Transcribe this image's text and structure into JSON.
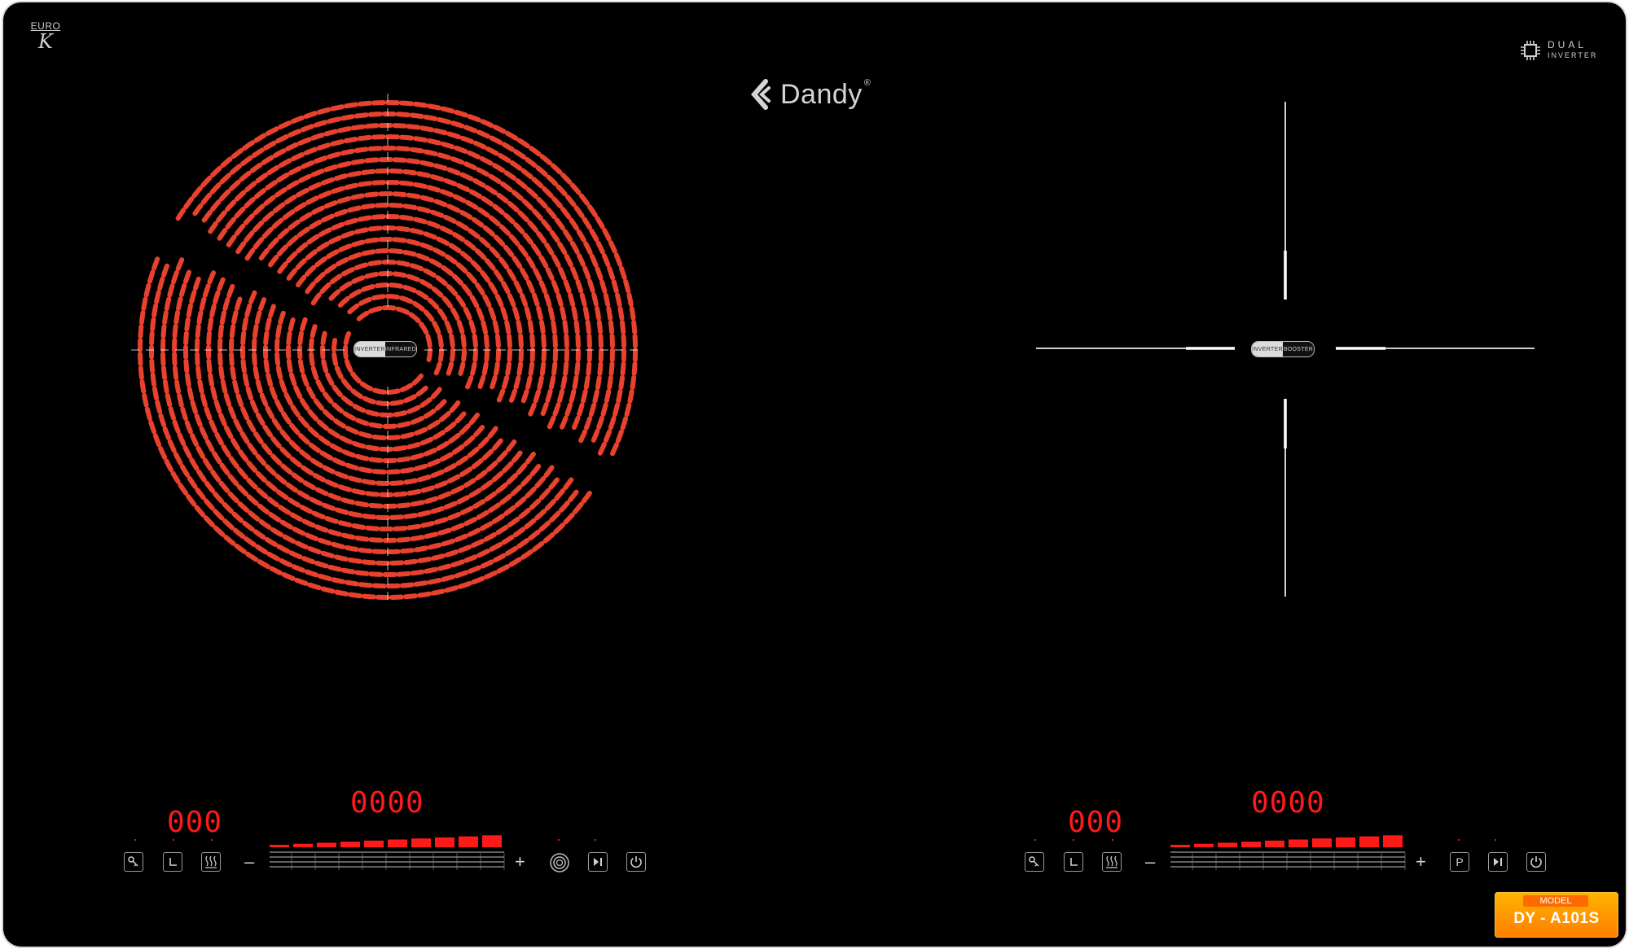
{
  "badges": {
    "euro_text": "EURO",
    "euro_mark": "K",
    "dual_line1": "DUAL",
    "dual_line2": "INVERTER"
  },
  "brand": {
    "name": "Dandy",
    "reg_mark": "®"
  },
  "zones": {
    "left": {
      "label_a": "INVERTER",
      "label_b": "INFRARED"
    },
    "right": {
      "label_a": "INVERTER",
      "label_b": "BOOSTER"
    }
  },
  "panels": {
    "left": {
      "timer": "000",
      "power": "0000",
      "minus": "–",
      "plus": "+",
      "level_bars": 10,
      "special_icon": "circle-mode-icon",
      "special_label": ""
    },
    "right": {
      "timer": "000",
      "power": "0000",
      "minus": "–",
      "plus": "+",
      "level_bars": 10,
      "special_icon": "p-mode-icon",
      "special_label": "P"
    }
  },
  "icons": [
    "key-lock-icon",
    "timer-icon",
    "keep-warm-icon",
    "pause-play-icon",
    "power-icon",
    "chip-icon"
  ],
  "model": {
    "label": "MODEL",
    "value": "DY - A101S"
  },
  "colors": {
    "glass": "#000000",
    "coil": "#e8412e",
    "display": "#ff1a1a",
    "silver": "#cfcfcf"
  }
}
